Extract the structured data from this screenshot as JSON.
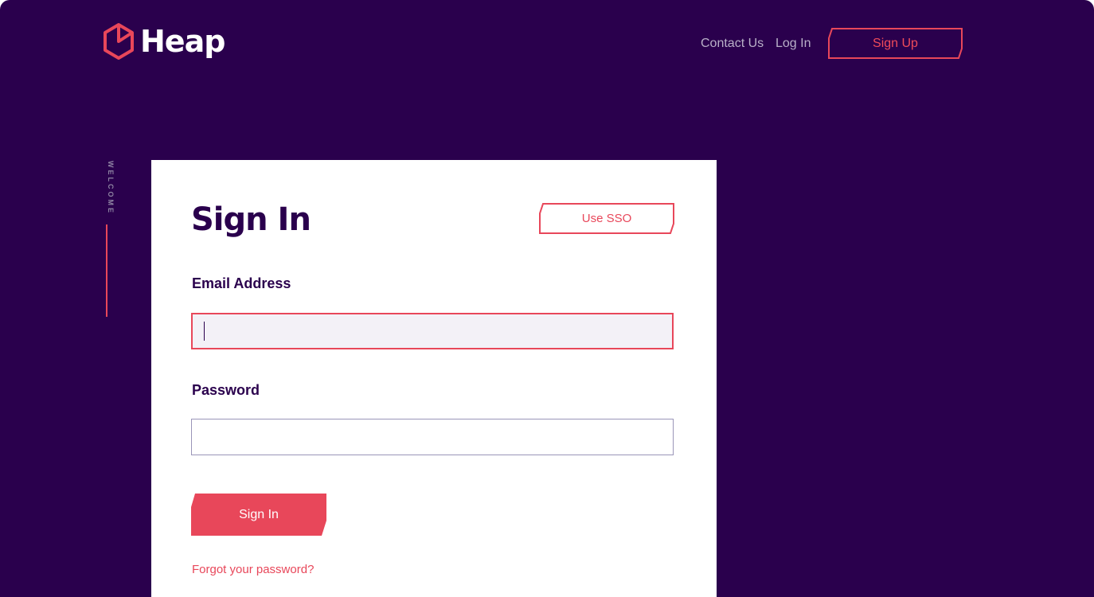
{
  "colors": {
    "background": "#2a004d",
    "accent": "#e8475a",
    "card": "#ffffff",
    "nav_text": "#b9b0c8"
  },
  "header": {
    "brand": "Heap",
    "logo_icon": "heap-hexagon-icon",
    "nav": {
      "contact_label": "Contact Us",
      "login_label": "Log In",
      "signup_label": "Sign Up"
    }
  },
  "side": {
    "welcome_label": "WELCOME"
  },
  "form": {
    "title": "Sign In",
    "sso_label": "Use SSO",
    "email_label": "Email Address",
    "email_value": "",
    "password_label": "Password",
    "password_value": "",
    "submit_label": "Sign In",
    "forgot_label": "Forgot your password?"
  }
}
